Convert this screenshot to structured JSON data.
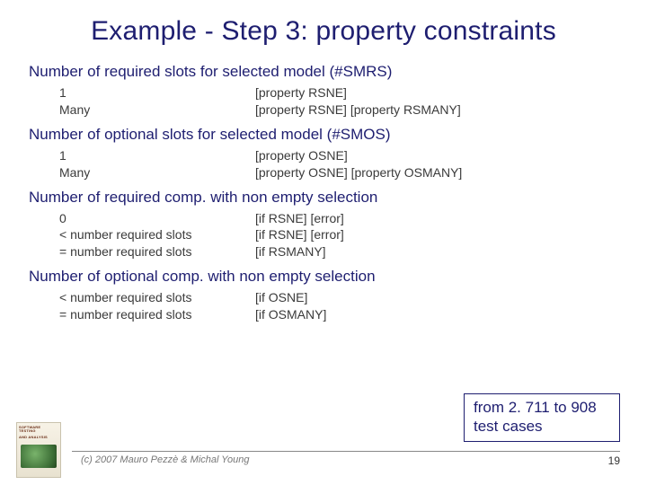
{
  "title": "Example - Step 3: property constraints",
  "sections": [
    {
      "heading": "Number of required slots for selected model (#SMRS)",
      "rows": [
        {
          "left": "1",
          "right": "[property RSNE]"
        },
        {
          "left": "Many",
          "right": "[property RSNE] [property RSMANY]"
        }
      ]
    },
    {
      "heading": "Number of optional slots for selected model (#SMOS)",
      "rows": [
        {
          "left": "1",
          "right": "[property OSNE]"
        },
        {
          "left": "Many",
          "right": "[property OSNE] [property OSMANY]"
        }
      ]
    },
    {
      "heading": "Number of required comp. with non empty selection",
      "rows": [
        {
          "left": "0",
          "right": "[if RSNE] [error]"
        },
        {
          "left": "< number required slots",
          "right": "[if RSNE] [error]"
        },
        {
          "left": "= number required slots",
          "right": "[if RSMANY]"
        }
      ]
    },
    {
      "heading": "Number of optional comp. with non empty selection",
      "rows": [
        {
          "left": "< number required slots",
          "right": "[if OSNE]"
        },
        {
          "left": "= number required slots",
          "right": "[if OSMANY]"
        }
      ]
    }
  ],
  "callout": {
    "line1": "from 2. 711 to 908",
    "line2": "test cases"
  },
  "footer": {
    "copyright": "(c) 2007 Mauro Pezzè & Michal Young",
    "page": "19"
  },
  "book": {
    "title_line1": "SOFTWARE TESTING",
    "title_line2": "AND ANALYSIS"
  }
}
